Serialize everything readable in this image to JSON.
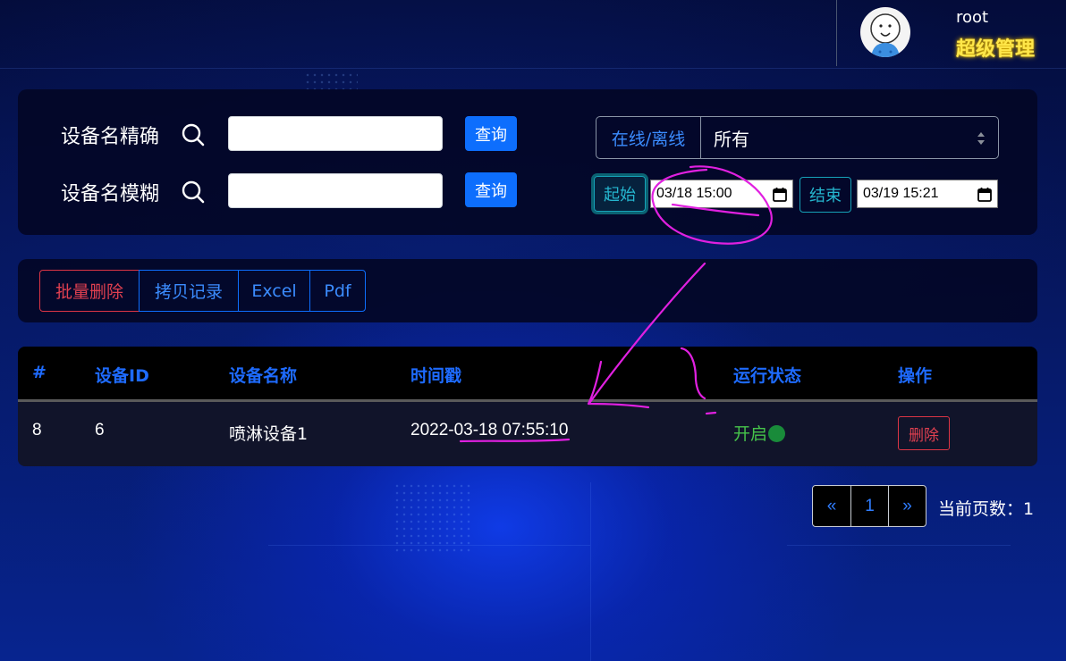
{
  "header": {
    "username": "root",
    "role": "超级管理",
    "avatar_icon": "cartoon-avatar-icon"
  },
  "search": {
    "exact_label": "设备名精确",
    "exact_value": "",
    "exact_button": "查询",
    "fuzzy_label": "设备名模糊",
    "fuzzy_value": "",
    "fuzzy_button": "查询",
    "status_prefix": "在线/离线",
    "status_selected": "所有",
    "start_button": "起始",
    "start_value": "03/18 15:00",
    "end_button": "结束",
    "end_value": "03/19 15:21"
  },
  "actions": {
    "batch_delete": "批量删除",
    "copy_records": "拷贝记录",
    "excel": "Excel",
    "pdf": "Pdf"
  },
  "table": {
    "headers": [
      "#",
      "设备ID",
      "设备名称",
      "时间戳",
      "运行状态",
      "操作"
    ],
    "rows": [
      {
        "index": "8",
        "device_id": "6",
        "device_name": "喷淋设备1",
        "timestamp": "2022-03-18 07:55:10",
        "status": "开启",
        "action": "删除"
      }
    ]
  },
  "pagination": {
    "prev": "«",
    "current": "1",
    "next": "»",
    "page_info": "当前页数：1"
  },
  "colors": {
    "accent": "#0d6efd",
    "danger": "#dc3545",
    "info": "#17a2b8",
    "role_text": "#ffe74a",
    "status_on": "#46c34a",
    "annotation": "#e020e0"
  }
}
